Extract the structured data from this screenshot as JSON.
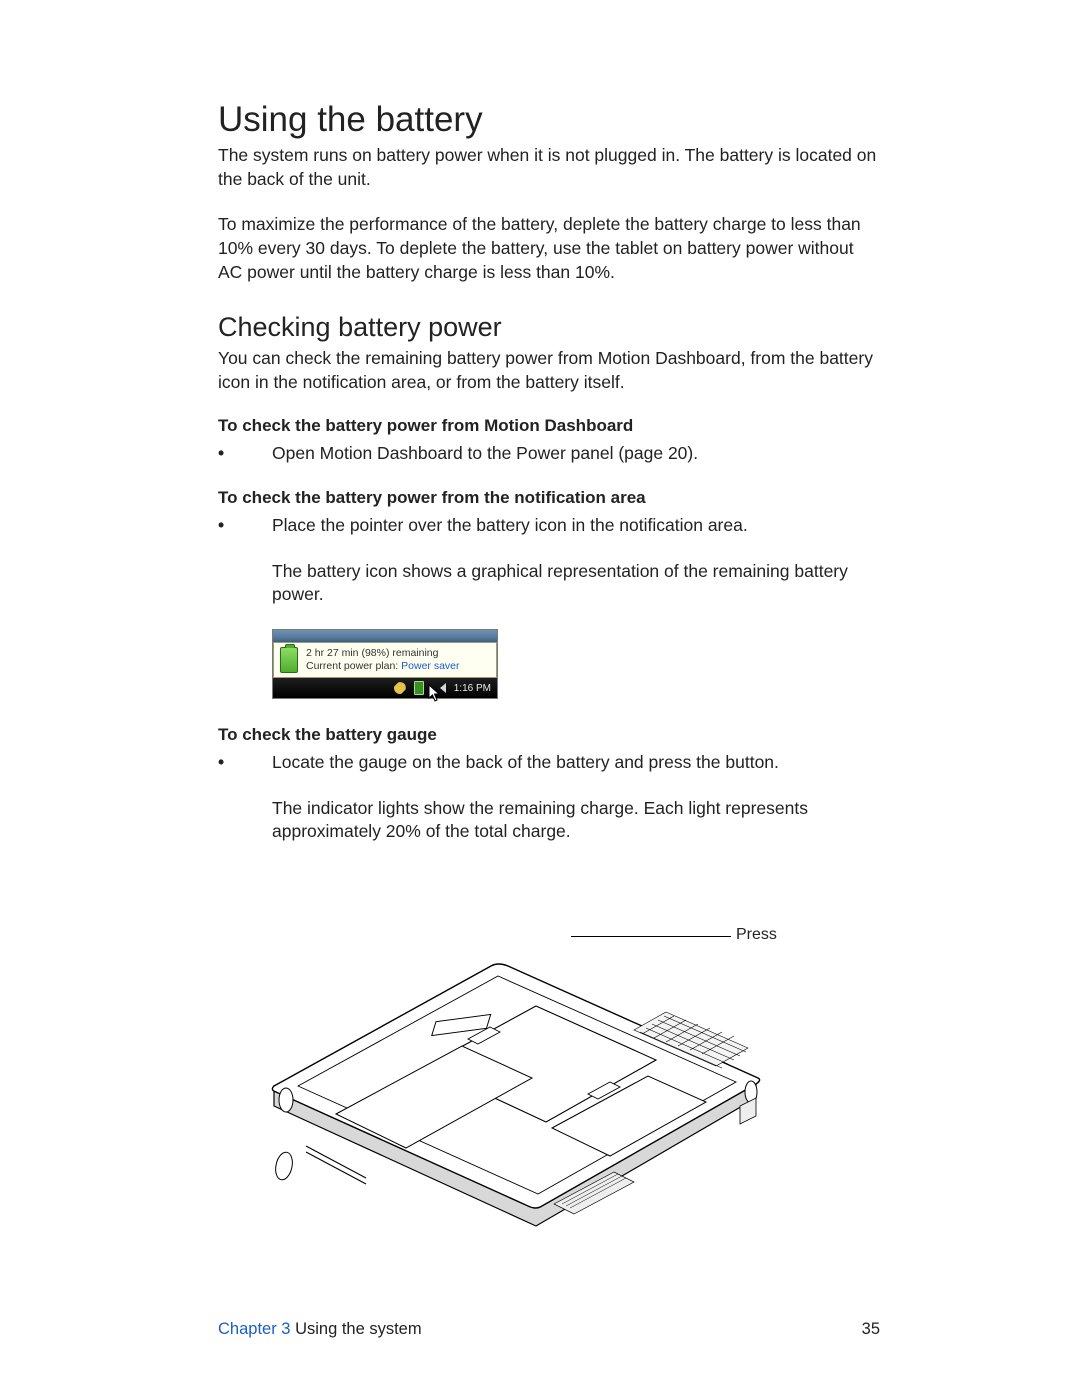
{
  "heading": "Using the battery",
  "para1": "The system runs on battery power when it is not plugged in. The battery is located on the back of the unit.",
  "para2": "To maximize the performance of the battery, deplete the battery charge to less than 10% every 30 days. To deplete the battery, use the tablet on battery power without AC power until the battery charge is less than 10%.",
  "subheading": "Checking battery power",
  "para3": "You can check the remaining battery power from Motion Dashboard, from the battery icon in the notification area, or from the battery itself.",
  "lead1": "To check the battery power from Motion Dashboard",
  "bullet1": "Open Motion Dashboard to the Power panel (page 20).",
  "lead2": "To check the battery power from the notification area",
  "bullet2": "Place the pointer over the battery icon in the notification area.",
  "para4": "The battery icon shows a graphical representation of the remaining battery power.",
  "notif": {
    "remaining": "2 hr 27 min (98%) remaining",
    "plan_label": "Current power plan:",
    "plan_value": "Power saver",
    "time": "1:16 PM"
  },
  "lead3": "To check the battery gauge",
  "bullet3": "Locate the gauge on the back of the battery and press the button.",
  "para5": "The indicator lights show the remaining charge. Each light represents approximately 20% of the total charge.",
  "device_callout": "Press",
  "footer": {
    "chapter": "Chapter 3",
    "title": "Using the system",
    "page": "35"
  }
}
